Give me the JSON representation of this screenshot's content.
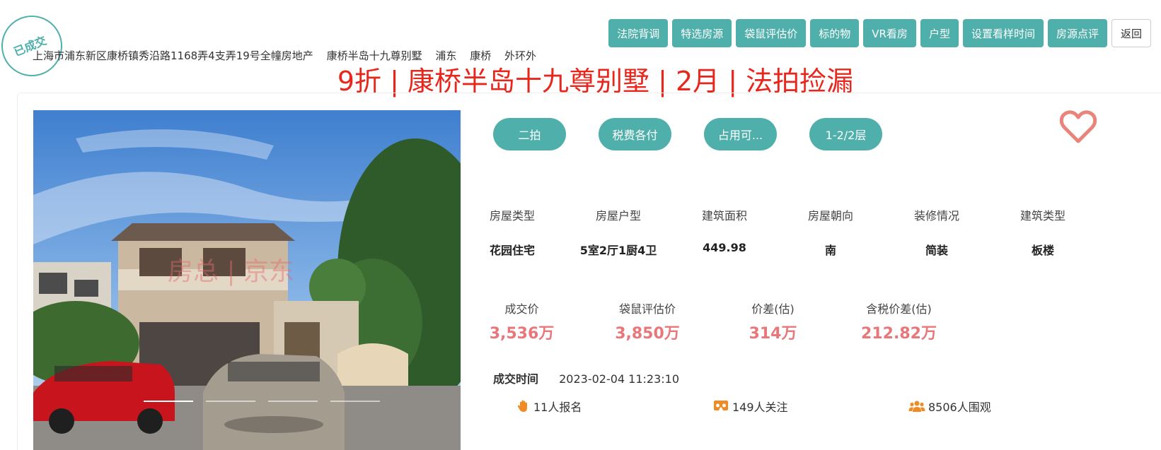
{
  "stamp": {
    "text": "已成交"
  },
  "address": {
    "parts": [
      "上海市浦东新区康桥镇秀沿路1168弄4支弄19号全幢房地产",
      "康桥半岛十九尊别墅",
      "浦东",
      "康桥",
      "外环外"
    ]
  },
  "toolbar": {
    "buttons": [
      "法院背调",
      "特选房源",
      "袋鼠评估价",
      "标的物",
      "VR看房",
      "户型",
      "设置看样时间",
      "房源点评"
    ],
    "back_label": "返回"
  },
  "headline": "9折 | 康桥半岛十九尊别墅 | 2月 | 法拍捡漏",
  "photo": {
    "watermark": "房总 | 京东"
  },
  "tags": [
    "二拍",
    "税费各付",
    "占用可...",
    "1-2/2层"
  ],
  "info": [
    {
      "label": "房屋类型",
      "value": "花园住宅"
    },
    {
      "label": "房屋户型",
      "value": "5室2厅1厨4卫"
    },
    {
      "label": "建筑面积",
      "value": "449.98"
    },
    {
      "label": "房屋朝向",
      "value": "南"
    },
    {
      "label": "装修情况",
      "value": "简装"
    },
    {
      "label": "建筑类型",
      "value": "板楼"
    }
  ],
  "prices": [
    {
      "label": "成交价",
      "value": "3,536万"
    },
    {
      "label": "袋鼠评估价",
      "value": "3,850万"
    },
    {
      "label": "价差(估)",
      "value": "314万"
    },
    {
      "label": "含税价差(估)",
      "value": "212.82万"
    }
  ],
  "deal_time": {
    "label": "成交时间",
    "value": "2023-02-04 11:23:10"
  },
  "stats": {
    "signup": "11人报名",
    "follow": "149人关注",
    "views": "8506人围观"
  },
  "colors": {
    "accent": "#4fb0ab",
    "headline": "#e8261c",
    "price": "#e9777a",
    "fav": "#e9847a"
  }
}
